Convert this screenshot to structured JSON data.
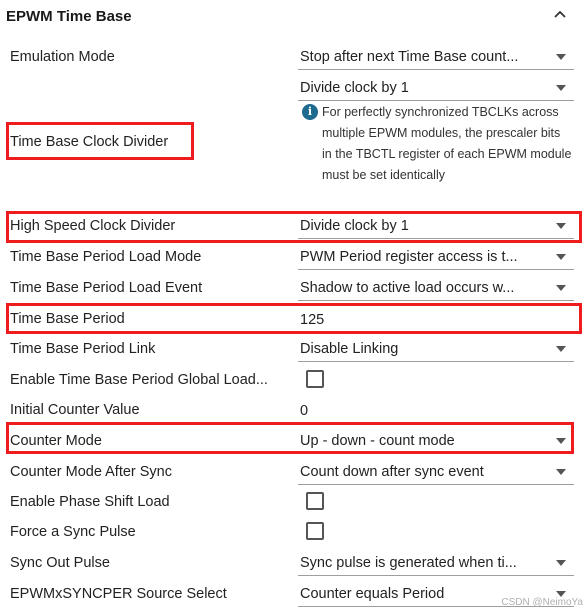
{
  "section": {
    "title": "EPWM Time Base",
    "collapse_icon": "chevron-up-icon"
  },
  "fields": {
    "emulation_mode": {
      "label": "Emulation Mode",
      "value": "Stop after next Time Base count..."
    },
    "time_base_clock_divider": {
      "label": "Time Base Clock Divider",
      "value": "Divide clock by 1",
      "info_icon": "info-icon",
      "info": "For perfectly synchronized TBCLKs across multiple EPWM modules, the prescaler bits in the TBCTL register of each EPWM module must be set identically"
    },
    "high_speed_clock_divider": {
      "label": "High Speed Clock Divider",
      "value": "Divide clock by 1"
    },
    "period_load_mode": {
      "label": "Time Base Period Load Mode",
      "value": "PWM Period register access is t..."
    },
    "period_load_event": {
      "label": "Time Base Period Load Event",
      "value": "Shadow to active load occurs w..."
    },
    "time_base_period": {
      "label": "Time Base Period",
      "value": "125"
    },
    "period_link": {
      "label": "Time Base Period Link",
      "value": "Disable Linking"
    },
    "period_global_load": {
      "label": "Enable Time Base Period Global Load...",
      "checked": false
    },
    "initial_counter_value": {
      "label": "Initial Counter Value",
      "value": "0"
    },
    "counter_mode": {
      "label": "Counter Mode",
      "value": "Up - down - count mode"
    },
    "counter_mode_after_sync": {
      "label": "Counter Mode After Sync",
      "value": "Count down after sync event"
    },
    "phase_shift_load": {
      "label": "Enable Phase Shift Load",
      "checked": false
    },
    "force_sync_pulse": {
      "label": "Force a Sync Pulse",
      "checked": false
    },
    "sync_out_pulse": {
      "label": "Sync Out Pulse",
      "value": "Sync pulse is generated when ti..."
    },
    "syncper_source": {
      "label": "EPWMxSYNCPER Source Select",
      "value": "Counter equals Period"
    }
  },
  "watermark": "CSDN @NeimoYa",
  "colors": {
    "highlight": "#ee1c1c",
    "info": "#1e6b8f"
  }
}
